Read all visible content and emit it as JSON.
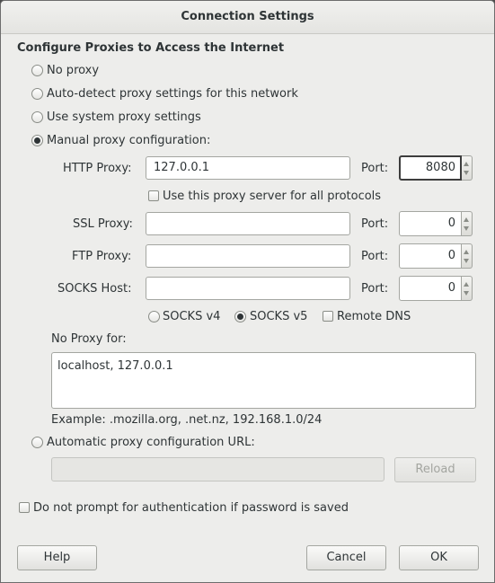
{
  "window": {
    "title": "Connection Settings"
  },
  "section_heading": "Configure Proxies to Access the Internet",
  "proxy_modes": {
    "no_proxy": {
      "label": "No proxy",
      "checked": false
    },
    "auto_detect": {
      "label": "Auto-detect proxy settings for this network",
      "checked": false
    },
    "system": {
      "label": "Use system proxy settings",
      "checked": false
    },
    "manual": {
      "label": "Manual proxy configuration:",
      "checked": true
    }
  },
  "manual": {
    "http": {
      "label": "HTTP Proxy:",
      "value": "127.0.0.1",
      "port_label": "Port:",
      "port": "8080"
    },
    "all_protocols": {
      "label": "Use this proxy server for all protocols",
      "checked": false
    },
    "ssl": {
      "label": "SSL Proxy:",
      "value": "",
      "port_label": "Port:",
      "port": "0"
    },
    "ftp": {
      "label": "FTP Proxy:",
      "value": "",
      "port_label": "Port:",
      "port": "0"
    },
    "socks": {
      "label": "SOCKS Host:",
      "value": "",
      "port_label": "Port:",
      "port": "0"
    },
    "socks_v4": {
      "label": "SOCKS v4",
      "checked": false
    },
    "socks_v5": {
      "label": "SOCKS v5",
      "checked": true
    },
    "remote_dns": {
      "label": "Remote DNS",
      "checked": false
    }
  },
  "no_proxy": {
    "label": "No Proxy for:",
    "value": "localhost, 127.0.0.1",
    "example": "Example: .mozilla.org, .net.nz, 192.168.1.0/24"
  },
  "auto_config": {
    "label": "Automatic proxy configuration URL:",
    "checked": false,
    "value": "",
    "reload_label": "Reload"
  },
  "no_prompt_auth": {
    "label": "Do not prompt for authentication if password is saved",
    "checked": false
  },
  "buttons": {
    "help": "Help",
    "cancel": "Cancel",
    "ok": "OK"
  }
}
